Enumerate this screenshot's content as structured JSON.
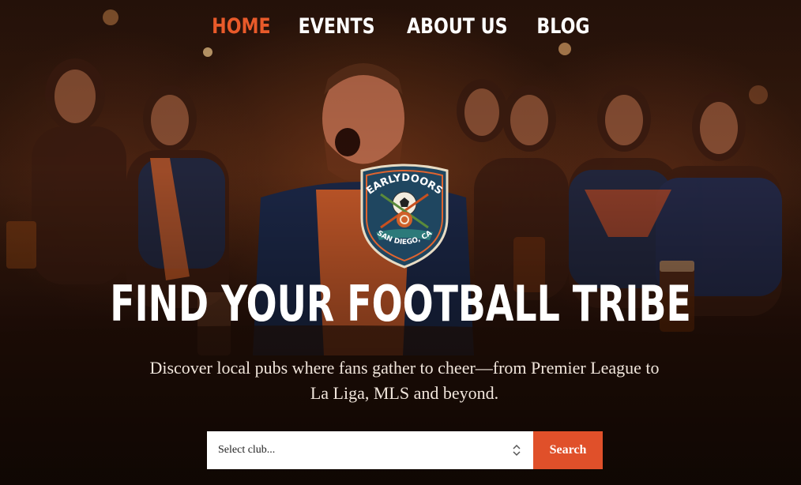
{
  "nav": {
    "items": [
      {
        "label": "HOME",
        "active": true
      },
      {
        "label": "EVENTS",
        "active": false
      },
      {
        "label": "ABOUT US",
        "active": false
      },
      {
        "label": "BLOG",
        "active": false
      }
    ]
  },
  "logo": {
    "top_text": "EARLYDOORS",
    "bottom_text": "SAN DIEGO, CA"
  },
  "hero": {
    "title": "FIND YOUR FOOTBALL TRIBE",
    "subtitle": "Discover local pubs where fans gather to cheer—from Premier League to La Liga, MLS and beyond."
  },
  "search": {
    "select_value": "Select club...",
    "button_label": "Search"
  },
  "colors": {
    "accent": "#e0502a",
    "nav_active": "#e85a2a",
    "text": "#ffffff"
  }
}
